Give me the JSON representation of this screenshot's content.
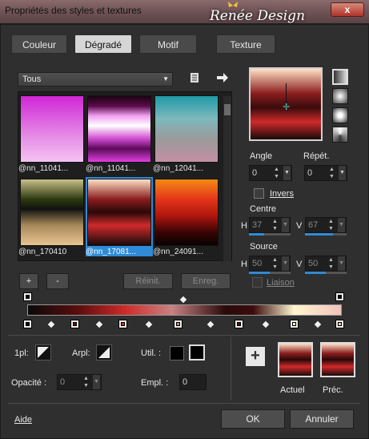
{
  "window": {
    "title": "Propriétés des styles et textures",
    "close_label": "x"
  },
  "watermark": {
    "text": "Renée Design"
  },
  "tabs": [
    {
      "label": "Couleur"
    },
    {
      "label": "Dégradé"
    },
    {
      "label": "Motif"
    },
    {
      "label": "Texture"
    }
  ],
  "category_dropdown": {
    "value": "Tous"
  },
  "gallery": {
    "items": [
      {
        "label": "@nn_11041...",
        "selected": false
      },
      {
        "label": "@nn_11041...",
        "selected": false
      },
      {
        "label": "@nn_12041...",
        "selected": false
      },
      {
        "label": "@nn_170410",
        "selected": false
      },
      {
        "label": "@nn_17081...",
        "selected": true
      },
      {
        "label": "@nn_24091...",
        "selected": false
      }
    ]
  },
  "gallery_buttons": {
    "add": "+",
    "remove": "-",
    "reset": "Réinit.",
    "save": "Enreg."
  },
  "angle": {
    "label": "Angle",
    "value": "0"
  },
  "repeat": {
    "label": "Répét.",
    "value": "0"
  },
  "invert": {
    "label": "Invers"
  },
  "center": {
    "label": "Centre",
    "h_label": "H",
    "h_value": "37",
    "v_label": "V",
    "v_value": "67"
  },
  "source": {
    "label": "Source",
    "h_label": "H",
    "h_value": "50",
    "v_label": "V",
    "v_value": "50"
  },
  "link": {
    "label": "Liaison"
  },
  "bottom": {
    "1pl_label": "1pl:",
    "arpl_label": "Arpl:",
    "util_label": "Util. :",
    "opacity_label": "Opacité :",
    "opacity_value": "0",
    "empl_label": "Empl. :",
    "empl_value": "0",
    "current_label": "Actuel",
    "previous_label": "Préc."
  },
  "footer": {
    "help": "Aide",
    "ok": "OK",
    "cancel": "Annuler"
  },
  "colors": {
    "accent": "#2f8bd8",
    "marker_cyan": "#3ad1c6"
  }
}
